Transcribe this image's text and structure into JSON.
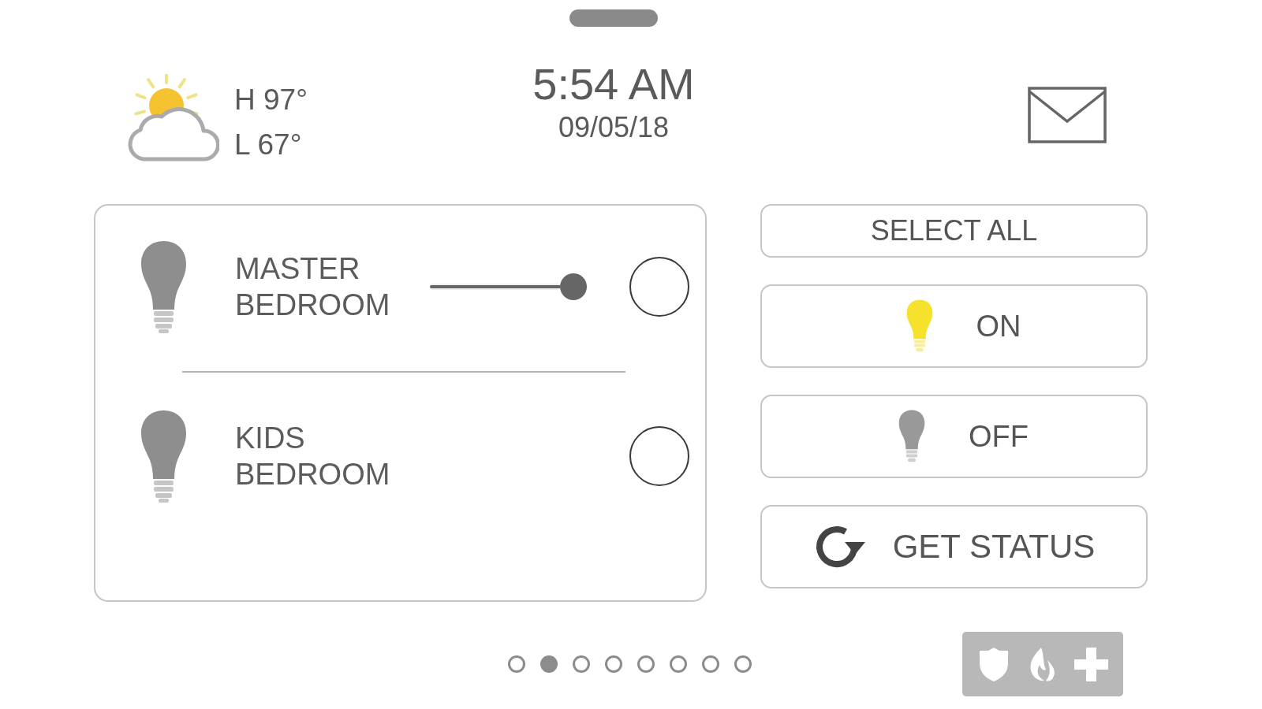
{
  "weather": {
    "high": "H 97°",
    "low": "L 67°"
  },
  "clock": {
    "time": "5:54 AM",
    "date": "09/05/18"
  },
  "lights": [
    {
      "name": "MASTER BEDROOM",
      "kind": "dimmer",
      "on": false,
      "level": 1,
      "selected": false
    },
    {
      "name": "KIDS BEDROOM",
      "kind": "switch",
      "on": false,
      "selected": false
    }
  ],
  "actions": [
    {
      "label": "SELECT ALL",
      "kind": "text"
    },
    {
      "label": "ON",
      "kind": "on"
    },
    {
      "label": "OFF",
      "kind": "off"
    },
    {
      "label": "GET STATUS",
      "kind": "refresh"
    }
  ],
  "pages": [
    {
      "selected": false
    },
    {
      "selected": true
    },
    {
      "selected": false
    },
    {
      "selected": false
    },
    {
      "selected": false
    },
    {
      "selected": false
    },
    {
      "selected": false
    },
    {
      "selected": false
    }
  ]
}
